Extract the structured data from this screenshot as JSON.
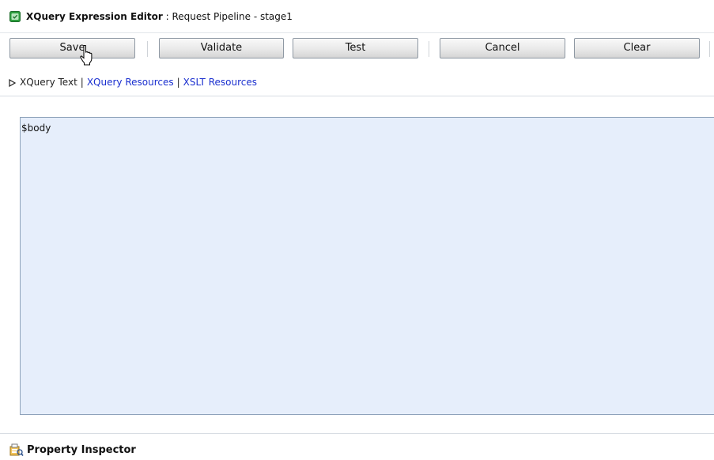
{
  "title_bar": {
    "editor_name": "XQuery Expression Editor",
    "context": " : Request Pipeline - stage1",
    "icon": "xquery-editor-icon"
  },
  "toolbar": {
    "save_label": "Save",
    "validate_label": "Validate",
    "test_label": "Test",
    "cancel_label": "Cancel",
    "clear_label": "Clear"
  },
  "resource_links": {
    "current": "XQuery Text",
    "separator": "|",
    "xquery_resources": "XQuery Resources",
    "xslt_resources": "XSLT Resources"
  },
  "editor": {
    "value": "$body"
  },
  "property_inspector": {
    "label": "Property Inspector",
    "icon": "property-inspector-icon"
  },
  "colors": {
    "link": "#1a2fcf",
    "editor_background": "#e6eefb",
    "icon_green": "#2e9e3f"
  }
}
